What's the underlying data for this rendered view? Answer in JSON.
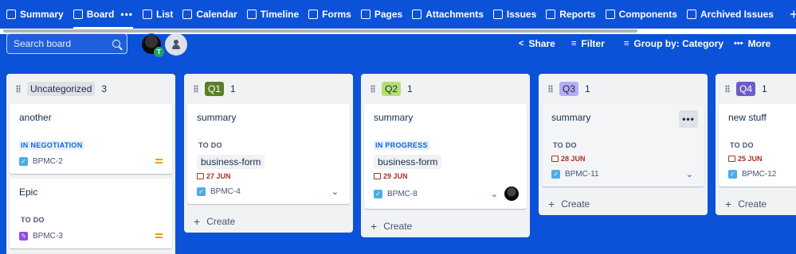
{
  "nav": {
    "tabs": [
      {
        "label": "Summary",
        "icon": "summary-icon"
      },
      {
        "label": "Board",
        "icon": "board-icon",
        "active": true
      },
      {
        "label": "List",
        "icon": "list-icon"
      },
      {
        "label": "Calendar",
        "icon": "calendar-icon"
      },
      {
        "label": "Timeline",
        "icon": "timeline-icon"
      },
      {
        "label": "Forms",
        "icon": "forms-icon"
      },
      {
        "label": "Pages",
        "icon": "pages-icon"
      },
      {
        "label": "Attachments",
        "icon": "attachments-icon"
      },
      {
        "label": "Issues",
        "icon": "issues-icon"
      },
      {
        "label": "Reports",
        "icon": "reports-icon"
      },
      {
        "label": "Components",
        "icon": "components-icon"
      },
      {
        "label": "Archived Issues",
        "icon": "archive-icon"
      }
    ],
    "board_more": "•••",
    "add": "+"
  },
  "toolbar": {
    "search_placeholder": "Search board",
    "avatar_badge": "T",
    "share": "Share",
    "filter": "Filter",
    "group_by": "Group by: Category",
    "more": "More"
  },
  "columns": [
    {
      "name": "Uncategorized",
      "count": "3",
      "color": "#dfe1e6",
      "cards": [
        {
          "title": "another",
          "status": "IN NEGOTIATION",
          "key": "BPMC-2",
          "type": "task",
          "priority": "medium"
        },
        {
          "title": "Epic",
          "status": "TO DO",
          "key": "BPMC-3",
          "type": "epic",
          "priority": "medium"
        }
      ]
    },
    {
      "name": "Q1",
      "count": "1",
      "color": "#5b7f24",
      "cards": [
        {
          "title": "summary",
          "status": "TO DO",
          "chip": "business-form",
          "date": "27 JUN",
          "key": "BPMC-4",
          "priority": "low"
        }
      ],
      "create": "Create"
    },
    {
      "name": "Q2",
      "count": "1",
      "color": "#b3df72",
      "cards": [
        {
          "title": "summary",
          "status": "IN PROGRESS",
          "chip": "business-form",
          "date": "29 JUN",
          "key": "BPMC-8",
          "priority": "low"
        }
      ],
      "create": "Create"
    },
    {
      "name": "Q3",
      "count": "1",
      "color": "#b8acf6",
      "cards": [
        {
          "title": "summary",
          "status": "TO DO",
          "date": "28 JUN",
          "key": "BPMC-11",
          "priority": "low",
          "more": "•••"
        }
      ],
      "create": "Create"
    },
    {
      "name": "Q4",
      "count": "1",
      "color": "#6e5dc6",
      "cards": [
        {
          "title": "new stuff",
          "status": "TO DO",
          "date": "25 JUN",
          "key": "BPMC-12"
        }
      ],
      "create": "Create"
    }
  ]
}
